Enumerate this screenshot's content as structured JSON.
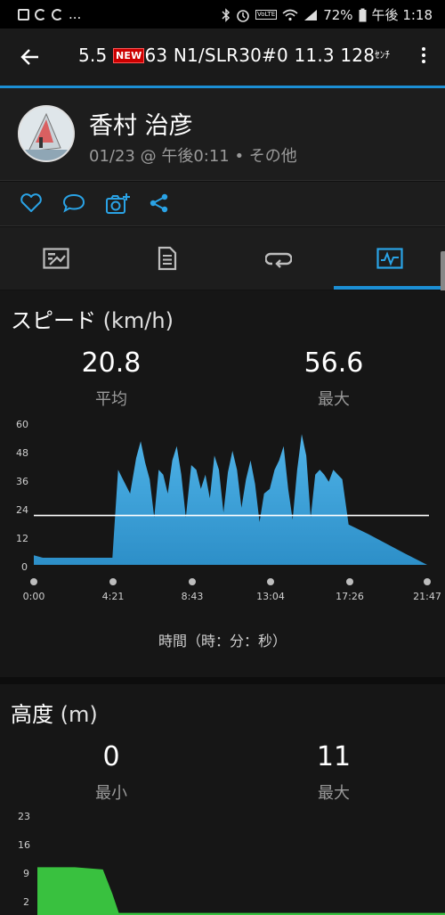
{
  "status_bar": {
    "left_icons": [
      "image-icon",
      "sync-icon",
      "sync-icon"
    ],
    "left_more": "...",
    "battery": "72%",
    "time": "午後 1:18",
    "volte": "VoLTE"
  },
  "app_bar": {
    "title_part1": "5.5 ",
    "new_badge": "NEW",
    "title_part2": "63 N1/SLR30#0 11.3  128",
    "title_unit": "ｾﾝﾁ"
  },
  "profile": {
    "name": "香村 治彦",
    "meta": "01/23 @ 午後0:11 • その他"
  },
  "actions": [
    "heart-icon",
    "comment-icon",
    "camera-add-icon",
    "share-icon"
  ],
  "tabs": [
    {
      "icon": "overview-icon",
      "selected": false
    },
    {
      "icon": "details-icon",
      "selected": false
    },
    {
      "icon": "laps-icon",
      "selected": false
    },
    {
      "icon": "charts-icon",
      "selected": true
    }
  ],
  "speed": {
    "title": "スピード",
    "unit": "(km/h)",
    "avg_value": "20.8",
    "avg_label": "平均",
    "max_value": "56.6",
    "max_label": "最大",
    "y_ticks": [
      "60",
      "48",
      "36",
      "24",
      "12",
      "0"
    ],
    "x_ticks": [
      "0:00",
      "4:21",
      "8:43",
      "13:04",
      "17:26",
      "21:47"
    ],
    "x_caption": "時間（時：分：秒）",
    "average_line": 20.8,
    "color": "#2d8fc8"
  },
  "altitude": {
    "title": "高度",
    "unit": "(m)",
    "min_value": "0",
    "min_label": "最小",
    "max_value": "11",
    "max_label": "最大",
    "y_ticks": [
      "23",
      "16",
      "9",
      "2"
    ],
    "color": "#39c13f"
  },
  "chart_data": [
    {
      "type": "area",
      "title": "スピード (km/h)",
      "xlabel": "時間（時：分：秒）",
      "ylabel": "",
      "x_ticks": [
        "0:00",
        "4:21",
        "8:43",
        "13:04",
        "17:26",
        "21:47"
      ],
      "x": [
        "0:00",
        "0:30",
        "1:00",
        "2:00",
        "3:00",
        "4:00",
        "4:21",
        "4:40",
        "5:00",
        "5:20",
        "5:40",
        "5:55",
        "6:10",
        "6:25",
        "6:40",
        "6:55",
        "7:10",
        "7:25",
        "7:40",
        "7:55",
        "8:10",
        "8:25",
        "8:43",
        "9:00",
        "9:15",
        "9:30",
        "9:45",
        "10:00",
        "10:15",
        "10:30",
        "10:45",
        "11:00",
        "11:15",
        "11:30",
        "11:45",
        "12:00",
        "12:15",
        "12:30",
        "12:45",
        "13:04",
        "13:20",
        "13:35",
        "13:50",
        "14:05",
        "14:20",
        "14:35",
        "14:50",
        "15:05",
        "15:20",
        "15:35",
        "15:50",
        "16:05",
        "16:20",
        "16:35",
        "16:50",
        "17:05",
        "17:26",
        "18:30",
        "19:30",
        "20:30",
        "21:47"
      ],
      "values": [
        4,
        3,
        3,
        3,
        3,
        3,
        3,
        40,
        35,
        30,
        45,
        52,
        43,
        36,
        20,
        40,
        38,
        30,
        44,
        50,
        38,
        20,
        42,
        40,
        32,
        38,
        28,
        46,
        40,
        22,
        39,
        48,
        40,
        24,
        36,
        44,
        34,
        18,
        30,
        32,
        40,
        44,
        50,
        32,
        19,
        40,
        55,
        46,
        20,
        38,
        40,
        38,
        35,
        40,
        38,
        36,
        17,
        13,
        9,
        5,
        0
      ],
      "average": 20.8,
      "ylim": [
        0,
        60
      ],
      "grid": false
    },
    {
      "type": "area",
      "title": "高度 (m)",
      "y_ticks": [
        "23",
        "16",
        "9",
        "2"
      ],
      "x": [
        "0:00",
        "2:00",
        "3:30",
        "4:00",
        "4:21",
        "21:47"
      ],
      "values": [
        11,
        11,
        10.5,
        5,
        0.5,
        0.5
      ],
      "ylim": [
        0,
        23
      ]
    }
  ]
}
